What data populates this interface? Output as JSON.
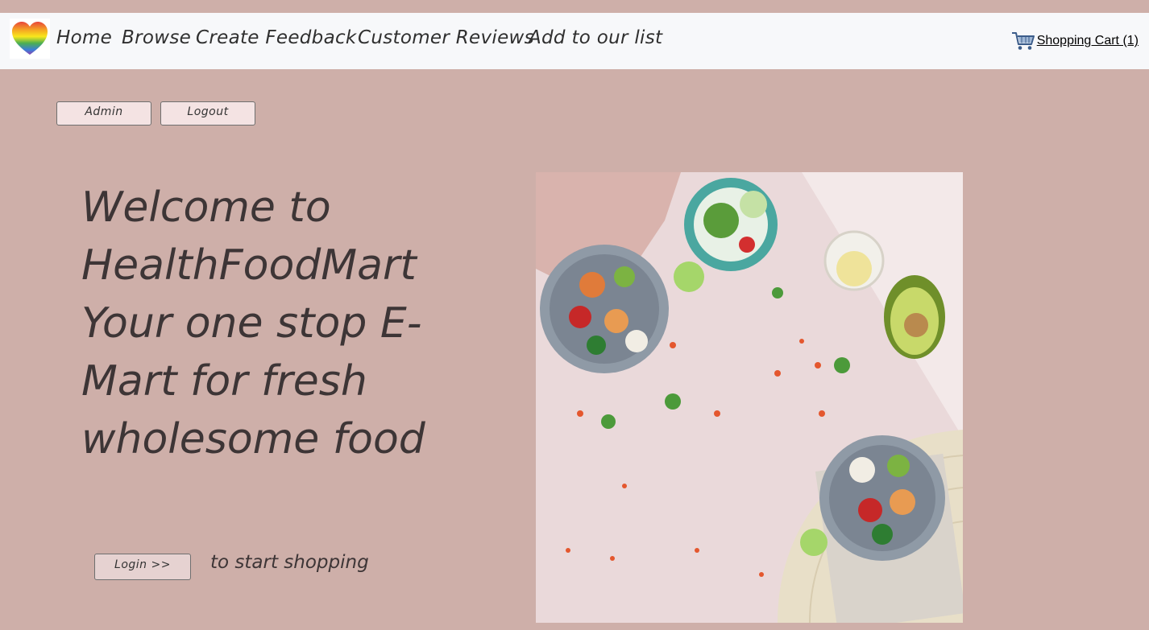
{
  "nav": {
    "logo_icon": "rainbow-heart-icon",
    "links": [
      "Home",
      "Browse",
      "Create Feedback",
      "Customer Reviews",
      "Add to our list"
    ],
    "cart_icon": "shopping-cart-icon",
    "cart_label": "Shopping Cart (1)"
  },
  "user_buttons": {
    "admin": "Admin",
    "logout": "Logout"
  },
  "hero": {
    "lines": [
      "Welcome to",
      "HealthFoodMart",
      "Your one stop E-",
      "Mart for fresh",
      "wholesome food"
    ],
    "login_button": "Login >>",
    "login_suffix": "to start shopping",
    "image_icon": "food-bowls-photo"
  },
  "colors": {
    "page_bg": "#ceafa9",
    "nav_bg": "#f7f8fa",
    "button_bg": "#f4e3e3",
    "text": "#3d3536"
  }
}
